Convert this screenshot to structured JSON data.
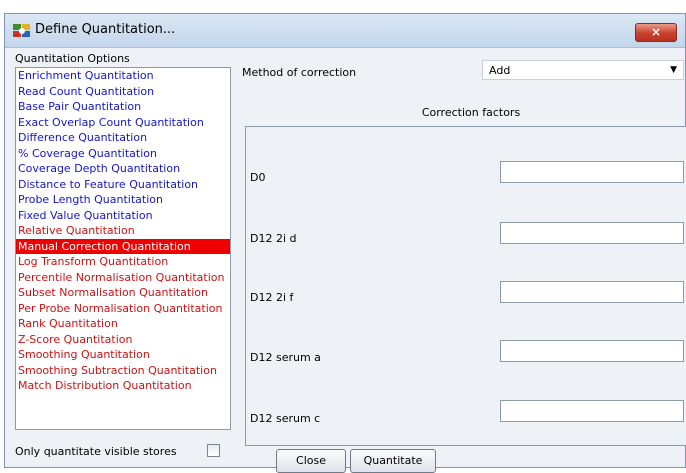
{
  "window": {
    "title": "Define Quantitation...",
    "close_glyph": "×"
  },
  "left": {
    "options_label": "Quantitation Options",
    "items": [
      {
        "label": "Enrichment Quantitation",
        "color": "blue"
      },
      {
        "label": "Read Count Quantitation",
        "color": "blue"
      },
      {
        "label": "Base Pair Quantitation",
        "color": "blue"
      },
      {
        "label": "Exact Overlap Count Quantitation",
        "color": "blue"
      },
      {
        "label": "Difference Quantitation",
        "color": "blue"
      },
      {
        "label": "% Coverage Quantitation",
        "color": "blue"
      },
      {
        "label": "Coverage Depth Quantitation",
        "color": "blue"
      },
      {
        "label": "Distance to Feature Quantitation",
        "color": "blue"
      },
      {
        "label": "Probe Length Quantitation",
        "color": "blue"
      },
      {
        "label": "Fixed Value Quantitation",
        "color": "blue"
      },
      {
        "label": "Relative Quantitation",
        "color": "red"
      },
      {
        "label": "Manual Correction Quantitation",
        "color": "red",
        "selected": true
      },
      {
        "label": "Log Transform Quantitation",
        "color": "red"
      },
      {
        "label": "Percentile Normalisation Quantitation",
        "color": "red"
      },
      {
        "label": "Subset Normalisation Quantitation",
        "color": "red"
      },
      {
        "label": "Per Probe Normalisation Quantitation",
        "color": "red"
      },
      {
        "label": "Rank Quantitation",
        "color": "red"
      },
      {
        "label": "Z-Score Quantitation",
        "color": "red"
      },
      {
        "label": "Smoothing Quantitation",
        "color": "red"
      },
      {
        "label": "Smoothing Subtraction Quantitation",
        "color": "red"
      },
      {
        "label": "Match Distribution Quantitation",
        "color": "red"
      }
    ],
    "visible_stores_label": "Only quantitate visible stores",
    "visible_stores_checked": false
  },
  "right": {
    "method_label": "Method of correction",
    "method_value": "Add",
    "correction_factors_label": "Correction factors",
    "factors": [
      {
        "label": "D0",
        "value": ""
      },
      {
        "label": "D12 2i d",
        "value": ""
      },
      {
        "label": "D12 2i f",
        "value": ""
      },
      {
        "label": "D12 serum a",
        "value": ""
      },
      {
        "label": "D12 serum c",
        "value": ""
      }
    ]
  },
  "buttons": {
    "close": "Close",
    "quantitate": "Quantitate"
  },
  "colors": {
    "blue_item": "#1515cc",
    "red_item": "#cc1111",
    "selected_bg": "#ee0000"
  }
}
